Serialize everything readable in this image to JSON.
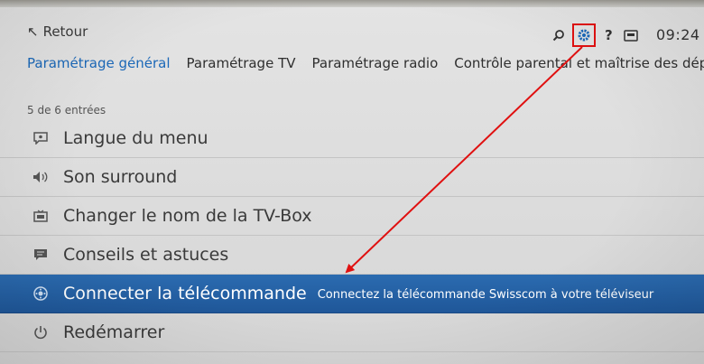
{
  "header": {
    "back_label": "Retour",
    "clock": "09:24"
  },
  "tabs": [
    {
      "label": "Paramétrage général",
      "active": true
    },
    {
      "label": "Paramétrage TV",
      "active": false
    },
    {
      "label": "Paramétrage radio",
      "active": false
    },
    {
      "label": "Contrôle parental et maîtrise des dépe",
      "active": false
    }
  ],
  "entry_count": "5 de 6 entrées",
  "menu": [
    {
      "label": "Langue du menu",
      "icon": "speech-bubble-icon"
    },
    {
      "label": "Son surround",
      "icon": "speaker-icon"
    },
    {
      "label": "Changer le nom de la TV-Box",
      "icon": "tv-box-icon"
    },
    {
      "label": "Conseils et astuces",
      "icon": "chat-icon"
    },
    {
      "label": "Connecter la télécommande",
      "icon": "remote-icon",
      "description": "Connectez la télécommande Swisscom à votre téléviseur",
      "selected": true
    },
    {
      "label": "Redémarrer",
      "icon": "power-icon"
    }
  ],
  "colors": {
    "accent": "#1b68b8",
    "selected_bg": "#2461a6",
    "annotation": "#e01010"
  }
}
